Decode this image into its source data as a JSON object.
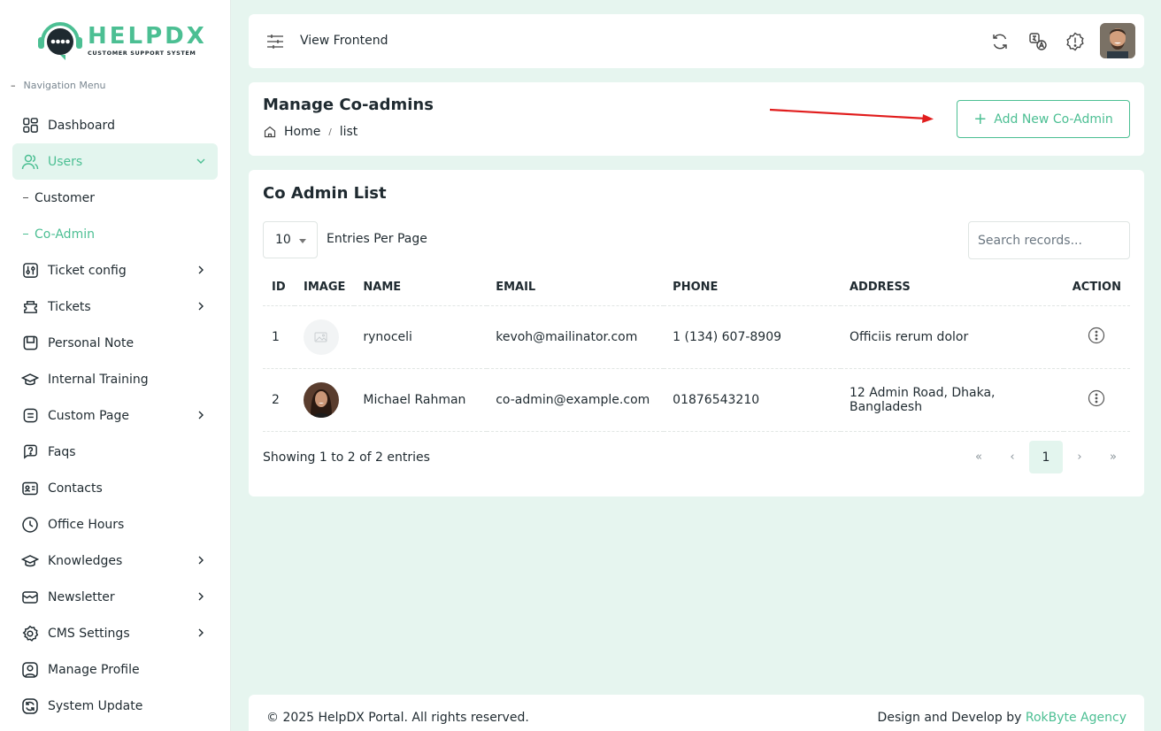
{
  "brand": {
    "name": "HELPDX",
    "tagline": "CUSTOMER SUPPORT SYSTEM",
    "accent": "#4cbf93"
  },
  "sidebar": {
    "heading": "Navigation Menu",
    "items": [
      {
        "label": "Dashboard",
        "icon": "dashboard-grid-icon"
      },
      {
        "label": "Users",
        "icon": "users-icon"
      },
      {
        "label": "Customer"
      },
      {
        "label": "Co-Admin"
      },
      {
        "label": "Ticket config",
        "icon": "sliders-icon"
      },
      {
        "label": "Tickets",
        "icon": "ticket-icon"
      },
      {
        "label": "Personal Note",
        "icon": "note-icon"
      },
      {
        "label": "Internal Training",
        "icon": "graduation-cap-icon"
      },
      {
        "label": "Custom Page",
        "icon": "page-icon"
      },
      {
        "label": "Faqs",
        "icon": "question-icon"
      },
      {
        "label": "Contacts",
        "icon": "contact-card-icon"
      },
      {
        "label": "Office Hours",
        "icon": "clock-icon"
      },
      {
        "label": "Knowledges",
        "icon": "book-cap-icon"
      },
      {
        "label": "Newsletter",
        "icon": "mail-icon"
      },
      {
        "label": "CMS Settings",
        "icon": "gear-icon"
      },
      {
        "label": "Manage Profile",
        "icon": "profile-icon"
      },
      {
        "label": "System Update",
        "icon": "update-icon"
      }
    ]
  },
  "topbar": {
    "view_frontend": "View Frontend"
  },
  "header": {
    "title": "Manage Co-admins",
    "breadcrumb": {
      "home": "Home",
      "separator": "/",
      "current": "list"
    },
    "add_button": "Add New Co-Admin"
  },
  "list": {
    "title": "Co Admin List",
    "per_page_value": "10",
    "per_page_label": "Entries Per Page",
    "search_placeholder": "Search records...",
    "columns": [
      "ID",
      "IMAGE",
      "NAME",
      "EMAIL",
      "PHONE",
      "ADDRESS",
      "ACTION"
    ],
    "rows": [
      {
        "id": "1",
        "name": "rynoceli",
        "email": "kevoh@mailinator.com",
        "phone": "1 (134) 607-8909",
        "address": "Officiis rerum dolor"
      },
      {
        "id": "2",
        "name": "Michael Rahman",
        "email": "co-admin@example.com",
        "phone": "01876543210",
        "address": "12 Admin Road, Dhaka, Bangladesh"
      }
    ],
    "showing": "Showing 1 to 2 of 2 entries",
    "pager": {
      "first": "«",
      "prev": "‹",
      "current": "1",
      "next": "›",
      "last": "»"
    }
  },
  "footer": {
    "copyright": "© 2025 HelpDX Portal. All rights reserved.",
    "credit_prefix": "Design and Develop by",
    "credit_agency": "RokByte Agency"
  }
}
